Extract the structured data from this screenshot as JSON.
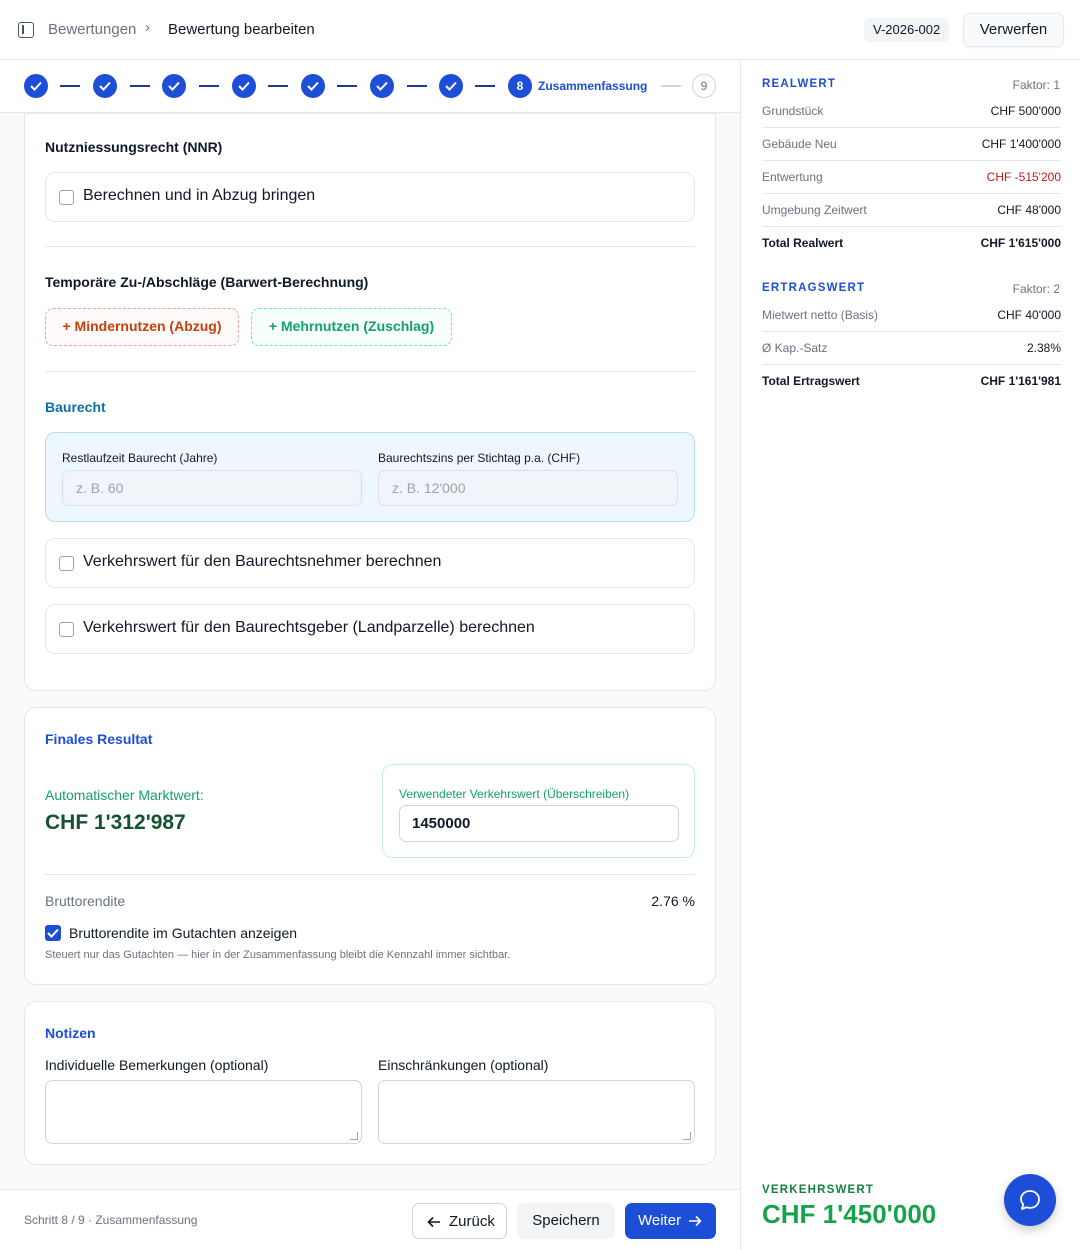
{
  "header": {
    "breadcrumb_parent": "Bewertungen",
    "breadcrumb_separator": "›",
    "breadcrumb_current": "Bewertung bearbeiten",
    "reference_badge": "V-2026-002",
    "discard_label": "Verwerfen"
  },
  "stepper": {
    "completed_steps": 7,
    "current_step_number": "8",
    "current_step_label": "Zusammenfassung",
    "next_step_number": "9"
  },
  "nnr": {
    "heading": "Nutzniessungsrecht (NNR)",
    "checkbox_label": "Berechnen und in Abzug bringen",
    "checked": false
  },
  "temporary": {
    "heading": "Temporäre Zu-/Abschläge (Barwert-Berechnung)",
    "minus_button": "+ Mindernutzen (Abzug)",
    "plus_button": "+ Mehrnutzen (Zuschlag)"
  },
  "baurecht": {
    "heading": "Baurecht",
    "remaining_label": "Restlaufzeit Baurecht (Jahre)",
    "remaining_placeholder": "z. B. 60",
    "interest_label": "Baurechtszins per Stichtag p.a. (CHF)",
    "interest_placeholder": "z. B. 12'000",
    "taker_checkbox": "Verkehrswert für den Baurechtsnehmer berechnen",
    "giver_checkbox": "Verkehrswert für den Baurechtsgeber (Landparzelle) berechnen"
  },
  "final": {
    "heading": "Finales Resultat",
    "auto_label": "Automatischer Marktwert:",
    "auto_value": "CHF 1'312'987",
    "override_label": "Verwendeter Verkehrswert (Überschreiben)",
    "override_value": "1450000",
    "brutto_label": "Bruttorendite",
    "brutto_value": "2.76 %",
    "show_checkbox_label": "Bruttorendite im Gutachten anzeigen",
    "show_checked": true,
    "hint": "Steuert nur das Gutachten — hier in der Zusammenfassung bleibt die Kennzahl immer sichtbar."
  },
  "notes": {
    "heading": "Notizen",
    "remarks_label": "Individuelle Bemerkungen (optional)",
    "restrictions_label": "Einschränkungen (optional)"
  },
  "footer": {
    "status": "Schritt 8 / 9 · Zusammenfassung",
    "back": "Zurück",
    "save": "Speichern",
    "next": "Weiter"
  },
  "summary": {
    "realwert": {
      "title": "REALWERT",
      "factor": "Faktor: 1",
      "rows": [
        {
          "label": "Grundstück",
          "value": "CHF 500'000"
        },
        {
          "label": "Gebäude Neu",
          "value": "CHF 1'400'000"
        },
        {
          "label": "Entwertung",
          "value": "CHF -515'200"
        },
        {
          "label": "Umgebung Zeitwert",
          "value": "CHF 48'000"
        }
      ],
      "total_label": "Total Realwert",
      "total_value": "CHF 1'615'000"
    },
    "ertragswert": {
      "title": "ERTRAGSWERT",
      "factor": "Faktor: 2",
      "rows": [
        {
          "label": "Mietwert netto (Basis)",
          "value": "CHF 40'000"
        },
        {
          "label": "Ø Kap.-Satz",
          "value": "2.38%"
        }
      ],
      "total_label": "Total Ertragswert",
      "total_value": "CHF 1'161'981"
    },
    "verkehrswert_label": "VERKEHRSWERT",
    "verkehrswert_value": "CHF 1'450'000"
  },
  "colors": {
    "primary": "#1d4ed8",
    "success": "#16a34a",
    "danger": "#b91c1c"
  }
}
